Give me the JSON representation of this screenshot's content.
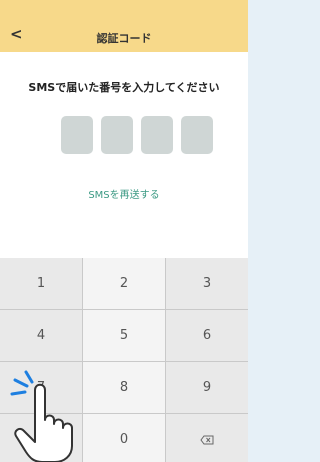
{
  "header": {
    "back_icon": "chevron-left-icon",
    "back_glyph": "<",
    "title": "認証コード"
  },
  "main": {
    "prompt": "SMSで届いた番号を入力してください",
    "code_boxes": 4,
    "resend_label": "SMSを再送する"
  },
  "keypad": {
    "keys": [
      "1",
      "2",
      "3",
      "4",
      "5",
      "6",
      "7",
      "8",
      "9",
      "",
      "0",
      "⌫"
    ],
    "delete_icon": "backspace-icon"
  },
  "overlay": {
    "hand_icon": "pointing-hand-icon",
    "tap_icon": "tap-effect-icon"
  },
  "colors": {
    "header": "#f7d98a",
    "code_box": "#cfd6d5",
    "link": "#3c9a84",
    "keypad_bg": "#dcdcdc"
  }
}
